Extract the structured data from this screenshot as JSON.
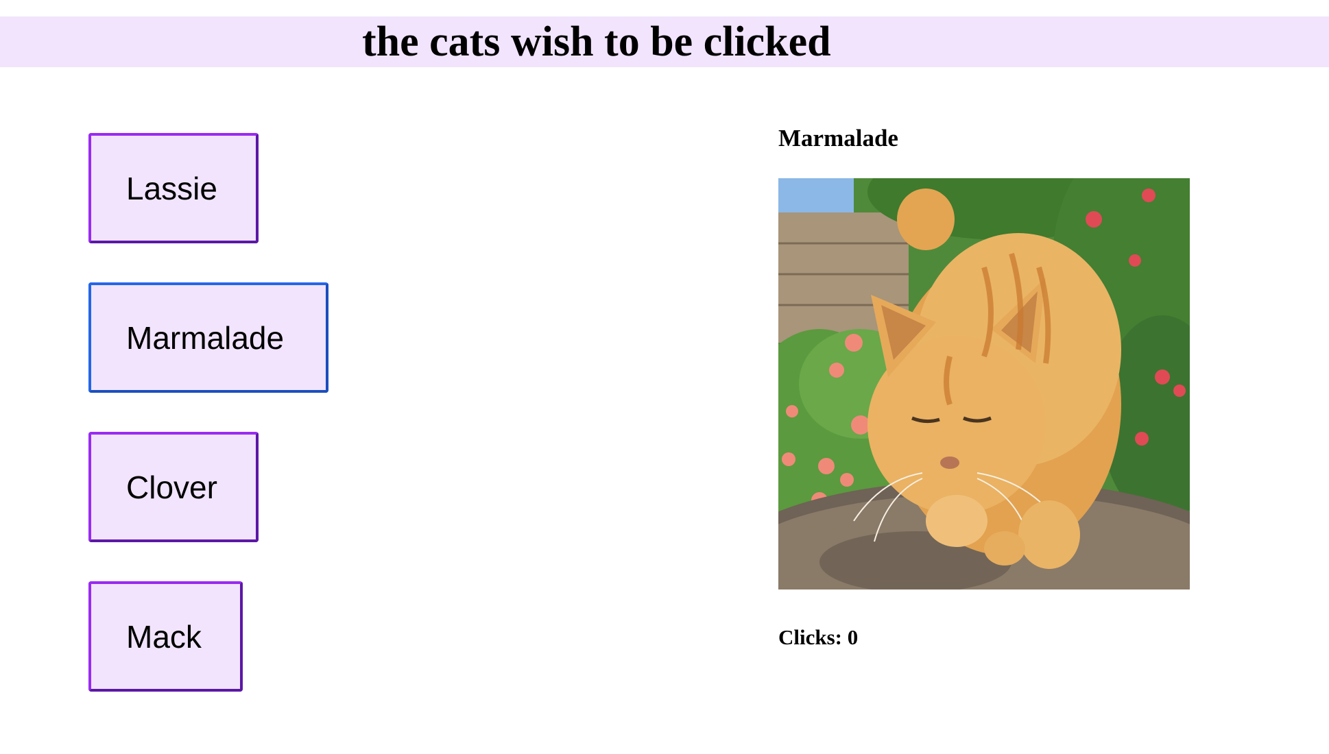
{
  "header": {
    "title": "the cats wish to be clicked"
  },
  "cat_list": {
    "items": [
      {
        "label": "Lassie",
        "selected": false
      },
      {
        "label": "Marmalade",
        "selected": true
      },
      {
        "label": "Clover",
        "selected": false
      },
      {
        "label": "Mack",
        "selected": false
      }
    ]
  },
  "detail": {
    "name": "Marmalade",
    "image_icon": "orange-cat-photo",
    "clicks_label": "Clicks:",
    "clicks_count": "0"
  },
  "colors": {
    "banner_bg": "#f1e4fc",
    "button_bg": "#f1e4fc",
    "button_border": "#9a2bf2",
    "selected_border": "#2466e6"
  }
}
